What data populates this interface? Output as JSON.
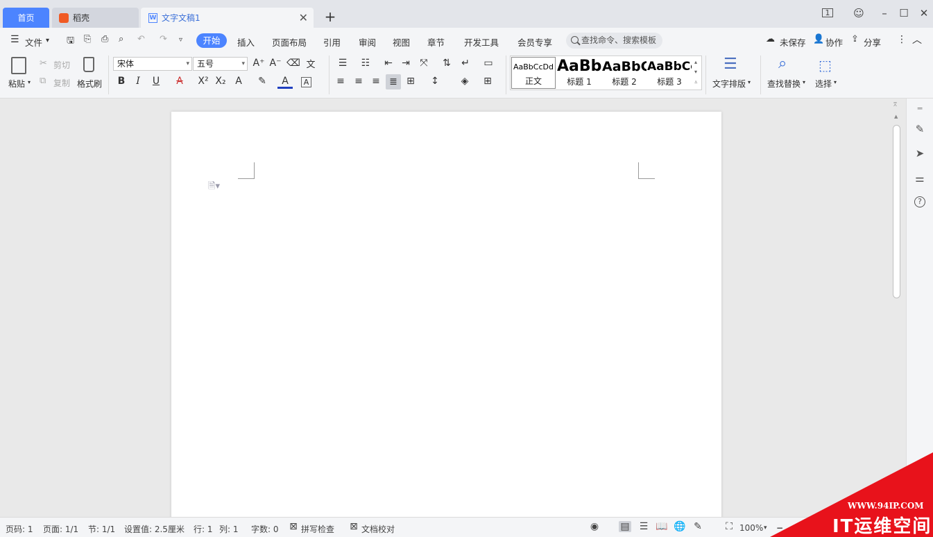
{
  "tabs": {
    "home": "首页",
    "daoke": "稻壳",
    "doc": "文字文稿1",
    "new_tab_symbol": "+"
  },
  "window": {
    "badge": "1"
  },
  "menu": {
    "file": "文件",
    "items": [
      "开始",
      "插入",
      "页面布局",
      "引用",
      "审阅",
      "视图",
      "章节",
      "开发工具",
      "会员专享"
    ],
    "active": "开始",
    "search_placeholder": "查找命令、搜索模板",
    "unsaved": "未保存",
    "collab": "协作",
    "share": "分享"
  },
  "ribbon": {
    "paste": "粘贴",
    "cut": "剪切",
    "copy": "复制",
    "format_painter": "格式刷",
    "font_name": "宋体",
    "font_size": "五号",
    "styles": [
      {
        "sample": "AaBbCcDd",
        "name": "正文"
      },
      {
        "sample": "AaBb",
        "name": "标题 1"
      },
      {
        "sample": "AaBbC",
        "name": "标题 2"
      },
      {
        "sample": "AaBbCc",
        "name": "标题 3"
      }
    ],
    "text_layout": "文字排版",
    "find_replace": "查找替换",
    "select": "选择"
  },
  "status": {
    "page_no": "页码: 1",
    "pages": "页面: 1/1",
    "section": "节: 1/1",
    "setting": "设置值: 2.5厘米",
    "row": "行: 1",
    "col": "列: 1",
    "words": "字数: 0",
    "spell_check": "拼写检查",
    "proofread": "文档校对",
    "zoom": "100%"
  },
  "watermark": {
    "url": "WWW.94IP.COM",
    "title": "IT运维空间"
  },
  "icons": [
    "menu-icon",
    "save-icon",
    "undo-icon",
    "redo-icon",
    "print-icon",
    "search-icon",
    "cloud-icon",
    "user-icon",
    "share-icon",
    "more-icon",
    "collapse-icon",
    "pen-icon",
    "cursor-icon",
    "sliders-icon",
    "help-icon",
    "eye-icon",
    "globe-icon"
  ]
}
